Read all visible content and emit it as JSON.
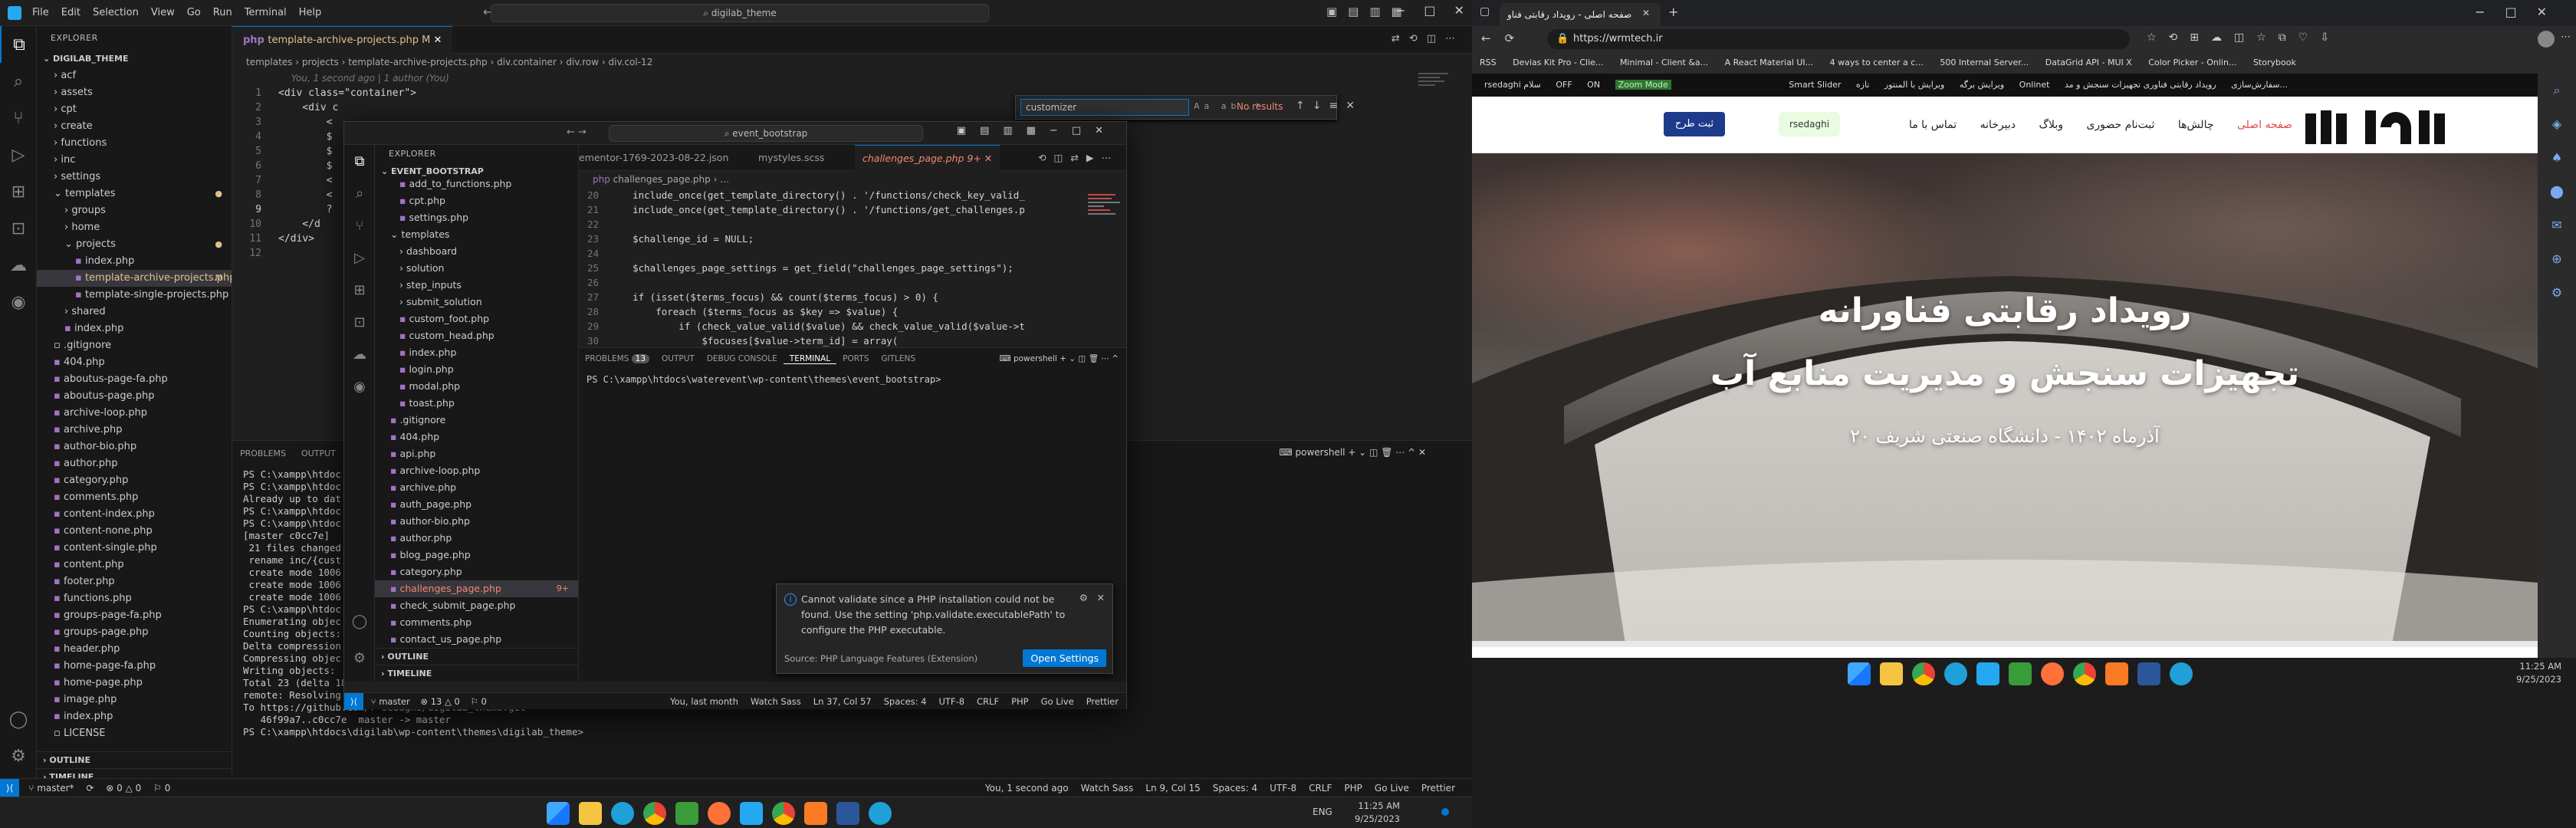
{
  "vs1": {
    "menu": [
      "File",
      "Edit",
      "Selection",
      "View",
      "Go",
      "Run",
      "Terminal",
      "Help"
    ],
    "command_center": "digilab_theme",
    "explorer_title": "EXPLORER",
    "workspace": "DIGILAB_THEME",
    "tree": [
      {
        "label": "acf",
        "depth": 1,
        "type": "folder"
      },
      {
        "label": "assets",
        "depth": 1,
        "type": "folder"
      },
      {
        "label": "cpt",
        "depth": 1,
        "type": "folder"
      },
      {
        "label": "create",
        "depth": 1,
        "type": "folder"
      },
      {
        "label": "functions",
        "depth": 1,
        "type": "folder"
      },
      {
        "label": "inc",
        "depth": 1,
        "type": "folder"
      },
      {
        "label": "settings",
        "depth": 1,
        "type": "folder"
      },
      {
        "label": "templates",
        "depth": 1,
        "type": "folder-open",
        "mark": "●"
      },
      {
        "label": "groups",
        "depth": 2,
        "type": "folder"
      },
      {
        "label": "home",
        "depth": 2,
        "type": "folder"
      },
      {
        "label": "projects",
        "depth": 2,
        "type": "folder-open",
        "mark": "●"
      },
      {
        "label": "index.php",
        "depth": 3,
        "type": "php"
      },
      {
        "label": "template-archive-projects.php",
        "depth": 3,
        "type": "php",
        "mark": "M",
        "selected": true
      },
      {
        "label": "template-single-projects.php",
        "depth": 3,
        "type": "php"
      },
      {
        "label": "shared",
        "depth": 2,
        "type": "folder"
      },
      {
        "label": "index.php",
        "depth": 2,
        "type": "php"
      },
      {
        "label": ".gitignore",
        "depth": 1,
        "type": "file"
      },
      {
        "label": "404.php",
        "depth": 1,
        "type": "php"
      },
      {
        "label": "aboutus-page-fa.php",
        "depth": 1,
        "type": "php"
      },
      {
        "label": "aboutus-page.php",
        "depth": 1,
        "type": "php"
      },
      {
        "label": "archive-loop.php",
        "depth": 1,
        "type": "php"
      },
      {
        "label": "archive.php",
        "depth": 1,
        "type": "php"
      },
      {
        "label": "author-bio.php",
        "depth": 1,
        "type": "php"
      },
      {
        "label": "author.php",
        "depth": 1,
        "type": "php"
      },
      {
        "label": "category.php",
        "depth": 1,
        "type": "php"
      },
      {
        "label": "comments.php",
        "depth": 1,
        "type": "php"
      },
      {
        "label": "content-index.php",
        "depth": 1,
        "type": "php"
      },
      {
        "label": "content-none.php",
        "depth": 1,
        "type": "php"
      },
      {
        "label": "content-single.php",
        "depth": 1,
        "type": "php"
      },
      {
        "label": "content.php",
        "depth": 1,
        "type": "php"
      },
      {
        "label": "footer.php",
        "depth": 1,
        "type": "php"
      },
      {
        "label": "functions.php",
        "depth": 1,
        "type": "php"
      },
      {
        "label": "groups-page-fa.php",
        "depth": 1,
        "type": "php"
      },
      {
        "label": "groups-page.php",
        "depth": 1,
        "type": "php"
      },
      {
        "label": "header.php",
        "depth": 1,
        "type": "php"
      },
      {
        "label": "home-page-fa.php",
        "depth": 1,
        "type": "php"
      },
      {
        "label": "home-page.php",
        "depth": 1,
        "type": "php"
      },
      {
        "label": "image.php",
        "depth": 1,
        "type": "php"
      },
      {
        "label": "index.php",
        "depth": 1,
        "type": "php"
      },
      {
        "label": "LICENSE",
        "depth": 1,
        "type": "file"
      }
    ],
    "outline": "OUTLINE",
    "timeline": "TIMELINE",
    "tab": "template-archive-projects.php",
    "tab_mark": "M",
    "breadcrumb": [
      "templates",
      "projects",
      "template-archive-projects.php",
      "div.container",
      "div.row",
      "div.col-12"
    ],
    "blame": "You, 1 second ago | 1 author (You)",
    "code": [
      {
        "n": "1",
        "t": "<div class=\"container\">"
      },
      {
        "n": "2",
        "t": "    <div c"
      },
      {
        "n": "3",
        "t": "        <"
      },
      {
        "n": "4",
        "t": "        $"
      },
      {
        "n": "5",
        "t": "        $"
      },
      {
        "n": "6",
        "t": "        $"
      },
      {
        "n": "7",
        "t": "        <"
      },
      {
        "n": "8",
        "t": "        <"
      },
      {
        "n": "9",
        "t": "        ?"
      },
      {
        "n": "10",
        "t": "    </d"
      },
      {
        "n": "11",
        "t": "</div>"
      },
      {
        "n": "12",
        "t": ""
      }
    ],
    "find": {
      "value": "customizer",
      "result": "No results"
    },
    "panel_tabs": [
      "PROBLEMS",
      "OUTPUT"
    ],
    "terminal_name": "powershell",
    "terminal": [
      "PS C:\\xampp\\htdoc",
      "PS C:\\xampp\\htdoc",
      "Already up to dat",
      "PS C:\\xampp\\htdoc",
      "PS C:\\xampp\\htdoc",
      "[master c0cc7e]",
      " 21 files changed",
      " rename inc/{cust",
      " create mode 1006",
      " create mode 1006",
      " create mode 1006",
      "PS C:\\xampp\\htdoc",
      "Enumerating objec",
      "Counting objects:",
      "Delta compression",
      "Compressing objec",
      "Writing objects:",
      "Total 23 (delta 18), reused 0 (delta 0), pack-reused 0",
      "remote: Resolving deltas: 100% (18/18), completed with 6 local objects.",
      "To https://github.com/r-sedaghi/digilab_theme.git",
      "   46f99a7..c0cc7e  master -> master",
      "PS C:\\xampp\\htdocs\\digilab\\wp-content\\themes\\digilab_theme> "
    ],
    "status_left": [
      "master*",
      "0 △ 0",
      "0"
    ],
    "status_right": [
      "You, 1 second ago",
      "Watch Sass",
      "Ln 9, Col 15",
      "Spaces: 4",
      "UTF-8",
      "CRLF",
      "PHP",
      "Go Live",
      "Prettier"
    ]
  },
  "vs2": {
    "search": "event_bootstrap",
    "explorer_title": "EXPLORER",
    "workspace": "EVENT_BOOTSTRAP",
    "tree": [
      {
        "label": "add_to_functions.php",
        "depth": 2
      },
      {
        "label": "cpt.php",
        "depth": 2
      },
      {
        "label": "settings.php",
        "depth": 2
      },
      {
        "label": "templates",
        "depth": 1,
        "folder": true,
        "open": true
      },
      {
        "label": "dashboard",
        "depth": 2,
        "folder": true
      },
      {
        "label": "solution",
        "depth": 2,
        "folder": true
      },
      {
        "label": "step_inputs",
        "depth": 2,
        "folder": true
      },
      {
        "label": "submit_solution",
        "depth": 2,
        "folder": true
      },
      {
        "label": "custom_foot.php",
        "depth": 2
      },
      {
        "label": "custom_head.php",
        "depth": 2
      },
      {
        "label": "index.php",
        "depth": 2
      },
      {
        "label": "login.php",
        "depth": 2
      },
      {
        "label": "modal.php",
        "depth": 2
      },
      {
        "label": "toast.php",
        "depth": 2
      },
      {
        "label": ".gitignore",
        "depth": 1
      },
      {
        "label": "404.php",
        "depth": 1
      },
      {
        "label": "api.php",
        "depth": 1
      },
      {
        "label": "archive-loop.php",
        "depth": 1
      },
      {
        "label": "archive.php",
        "depth": 1
      },
      {
        "label": "auth_page.php",
        "depth": 1
      },
      {
        "label": "author-bio.php",
        "depth": 1
      },
      {
        "label": "author.php",
        "depth": 1
      },
      {
        "label": "blog_page.php",
        "depth": 1
      },
      {
        "label": "category.php",
        "depth": 1
      },
      {
        "label": "challenges_page.php",
        "depth": 1,
        "mark": "9+",
        "selected": true
      },
      {
        "label": "check_submit_page.php",
        "depth": 1
      },
      {
        "label": "comments.php",
        "depth": 1
      },
      {
        "label": "contact_us_page.php",
        "depth": 1
      }
    ],
    "outline": "OUTLINE",
    "timeline": "TIMELINE",
    "tabs": [
      "ementor-1769-2023-08-22.json",
      "mystyles.scss",
      "challenges_page.php"
    ],
    "tab_mark": "9+",
    "crumb": "challenges_page.php",
    "code": [
      {
        "n": "20",
        "t": "    include_once(get_template_directory() . '/functions/check_key_valid_"
      },
      {
        "n": "21",
        "t": "    include_once(get_template_directory() . '/functions/get_challenges.p"
      },
      {
        "n": "22",
        "t": ""
      },
      {
        "n": "23",
        "t": "    $challenge_id = NULL;"
      },
      {
        "n": "24",
        "t": ""
      },
      {
        "n": "25",
        "t": "    $challenges_page_settings = get_field(\"challenges_page_settings\");"
      },
      {
        "n": "26",
        "t": ""
      },
      {
        "n": "27",
        "t": "    if (isset($terms_focus) && count($terms_focus) > 0) {"
      },
      {
        "n": "28",
        "t": "        foreach ($terms_focus as $key => $value) {"
      },
      {
        "n": "29",
        "t": "            if (check_value_valid($value) && check_value_valid($value->t"
      },
      {
        "n": "30",
        "t": "                $focuses[$value->term_id] = array("
      }
    ],
    "panel_tabs": [
      "PROBLEMS",
      "OUTPUT",
      "DEBUG CONSOLE",
      "TERMINAL",
      "PORTS",
      "GITLENS"
    ],
    "problems_count": "13",
    "terminal_name": "powershell",
    "terminal": "PS C:\\xampp\\htdocs\\waterevent\\wp-content\\themes\\event_bootstrap>",
    "notif_text": "Cannot validate since a PHP installation could not be found. Use the setting 'php.validate.executablePath' to configure the PHP executable.",
    "notif_source": "Source: PHP Language Features (Extension)",
    "notif_button": "Open Settings",
    "status_left": [
      "master",
      "13 △ 0",
      "0"
    ],
    "status_right": [
      "You, last month",
      "Watch Sass",
      "Ln 37, Col 57",
      "Spaces: 4",
      "UTF-8",
      "CRLF",
      "PHP",
      "Go Live",
      "Prettier"
    ]
  },
  "browser": {
    "tab_title": "صفحه اصلی - رویداد رقابتی فناو",
    "url": "https://wrmtech.ir",
    "bookmarks": [
      "RSS",
      "Devias Kit Pro - Clie...",
      "Minimal - Client &a...",
      "A React Material UI...",
      "4 ways to center a c...",
      "500 Internal Server...",
      "DataGrid API - MUI X",
      "Color Picker - Onlin...",
      "Storybook"
    ],
    "adminbar": [
      "rsedaghi سلام",
      "OFF",
      "ON",
      "Zoom Mode",
      "Smart Slider",
      "ویرایش برگه",
      "ویرایش با المنتور",
      "تازه",
      "Onlinet",
      "سفارش‌سازی",
      "رویداد رقابتی فناوری تجهیزات سنجش و مد..."
    ],
    "nav": [
      "صفحه اصلی",
      "چالش‌ها",
      "ثبت‌نام حضوری",
      "وبلاگ",
      "دبیرخانه",
      "تماس با ما"
    ],
    "user": "rsedaghi",
    "cta": "ثبت طرح",
    "hero_line1": "رویداد رقابتی فناورانه",
    "hero_line2": "تجهیزات سنجش و مدیریت منابع آب",
    "hero_line3": "۲۰ آذرماه ۱۴۰۲ - دانشگاه صنعتی شریف"
  },
  "taskbar": {
    "lang": "ENG",
    "time": "11:25 AM",
    "date": "9/25/2023"
  },
  "colors": {
    "accent": "#0078d4",
    "cta": "#1e3a8a",
    "nav_active": "#e34b4b"
  }
}
